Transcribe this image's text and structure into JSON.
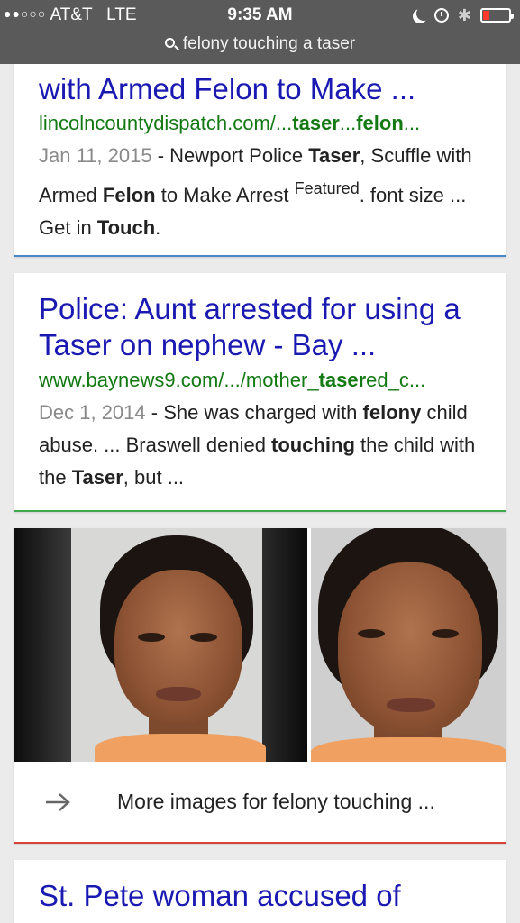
{
  "status_bar": {
    "signal": "●●○○○",
    "carrier": "AT&T",
    "network": "LTE",
    "time": "9:35 AM",
    "icons": [
      "moon-icon",
      "alarm-icon",
      "bluetooth-icon",
      "battery-icon"
    ],
    "battery_color": "#ff3b30"
  },
  "address_bar": {
    "query": "felony touching a taser"
  },
  "results": [
    {
      "title": "with Armed Felon to Make ...",
      "url_parts": [
        "lincolncountydispatch.com/...",
        "taser",
        "...",
        "felon",
        "..."
      ],
      "date": "Jan 11, 2015",
      "snippet_parts": [
        " - Newport Police ",
        "Taser",
        ", Scuffle with Armed ",
        "Felon",
        " to Make Arrest ",
        "Featured",
        ". font size ... Get in ",
        "Touch",
        "."
      ],
      "accent": "#4a86c9"
    },
    {
      "title": "Police: Aunt arrested for using a Taser on nephew - Bay ...",
      "url_parts": [
        "www.baynews9.com/.../mother_",
        "taser",
        "ed_c..."
      ],
      "date": "Dec 1, 2014",
      "snippet_parts": [
        " - She was charged with ",
        "felony",
        " child abuse. ... Braswell denied ",
        "touching",
        " the child with the ",
        "Taser",
        ", but ..."
      ],
      "accent": "#3fa64a"
    },
    {
      "title": "St. Pete woman accused of"
    }
  ],
  "images_card": {
    "more_label": "More images for felony touching ...",
    "accent": "#d7423b"
  },
  "colors": {
    "title_link": "#1a1ab3",
    "url_green": "#137a13",
    "date_gray": "#8a8a8a"
  }
}
